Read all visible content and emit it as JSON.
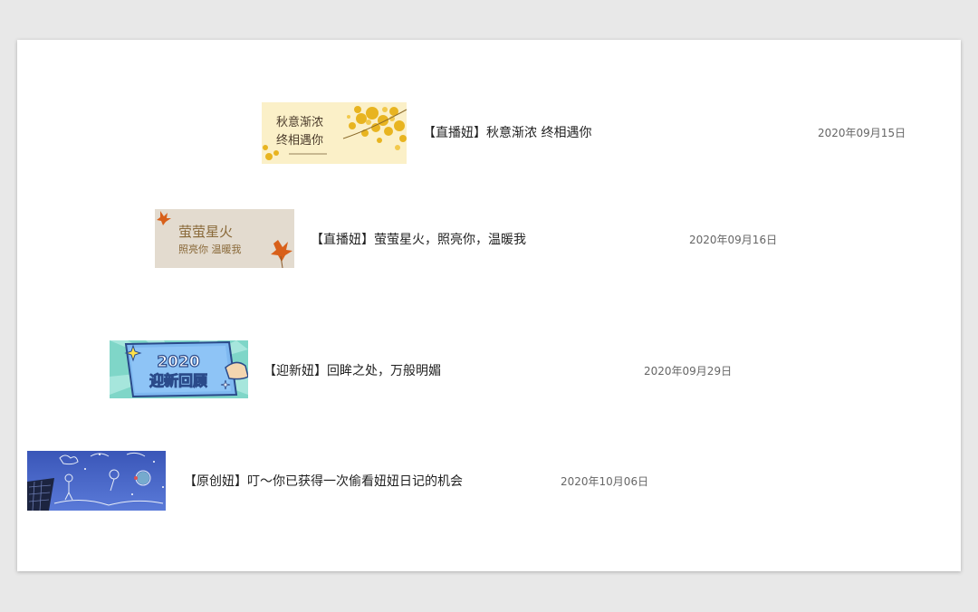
{
  "articles": [
    {
      "thumb_text_1": "秋意渐浓",
      "thumb_text_2": "终相遇你",
      "title": "【直播妞】秋意渐浓 终相遇你",
      "date": "2020年09月15日"
    },
    {
      "thumb_text_1": "萤萤星火",
      "thumb_text_2": "照亮你 温暖我",
      "title": "【直播妞】萤萤星火，照亮你，温暖我",
      "date": "2020年09月16日"
    },
    {
      "thumb_text_1": "2020",
      "thumb_text_2": "迎新回顾",
      "title": "【迎新妞】回眸之处，万般明媚",
      "date": "2020年09月29日"
    },
    {
      "title": "【原创妞】叮～你已获得一次偷看妞妞日记的机会",
      "date": "2020年10月06日"
    }
  ]
}
